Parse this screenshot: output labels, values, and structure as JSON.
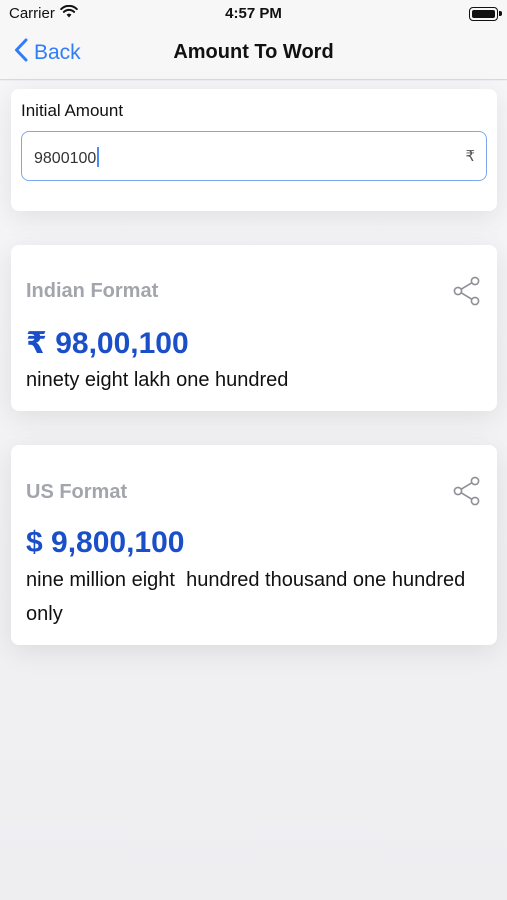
{
  "status_bar": {
    "carrier": "Carrier",
    "time": "4:57 PM"
  },
  "nav": {
    "back_label": "Back",
    "title": "Amount To Word"
  },
  "input": {
    "label": "Initial Amount",
    "value": "9800100",
    "currency_symbol": "₹"
  },
  "indian_format": {
    "label": "Indian Format",
    "amount": "₹ 98,00,100",
    "words": "ninety eight lakh one hundred"
  },
  "us_format": {
    "label": "US Format",
    "amount": "$ 9,800,100",
    "words": "nine million eight  hundred thousand one hundred only"
  },
  "colors": {
    "accent": "#2f7ef6",
    "amount_blue": "#1a4fc8",
    "label_gray": "#a2a5ab",
    "field_border": "#7ea8ee"
  },
  "icons": [
    "chevron-left-icon",
    "wifi-icon",
    "battery-icon",
    "share-icon"
  ]
}
